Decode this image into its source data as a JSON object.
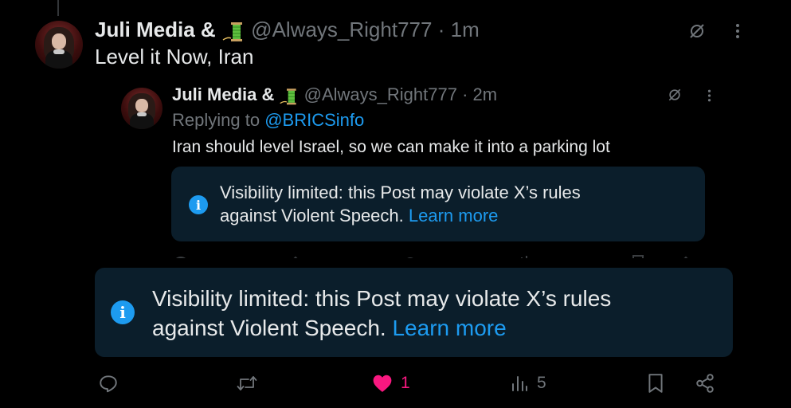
{
  "main_post": {
    "display_name": "Juli Media &",
    "handle": "@Always_Right777",
    "separator": "·",
    "time": "1m",
    "text": "Level it Now, Iran"
  },
  "quoted_post": {
    "display_name": "Juli Media &",
    "handle": "@Always_Right777",
    "separator": "·",
    "time": "2m",
    "replying_prefix": "Replying to",
    "replying_to": "@BRICSinfo",
    "text": "Iran should level Israel, so we can make it into a parking lot",
    "notice_line1": "Visibility limited: this Post may violate X’s rules",
    "notice_line2": "against Violent Speech.",
    "notice_link": "Learn more"
  },
  "notice": {
    "line1": "Visibility limited: this Post may violate X’s rules",
    "line2": "against Violent Speech.",
    "link": "Learn more"
  },
  "actions": {
    "likes": "1",
    "views": "5"
  },
  "colors": {
    "background": "#000000",
    "text": "#e7e9ea",
    "muted": "#71767b",
    "accent": "#1d9bf0",
    "like": "#f91880",
    "notice_bg": "#0b1e2b"
  },
  "icons": [
    "grok-slash-icon",
    "more-icon",
    "info-icon",
    "reply-icon",
    "repost-icon",
    "heart-icon",
    "views-icon",
    "bookmark-icon",
    "share-icon",
    "spool-emoji"
  ]
}
